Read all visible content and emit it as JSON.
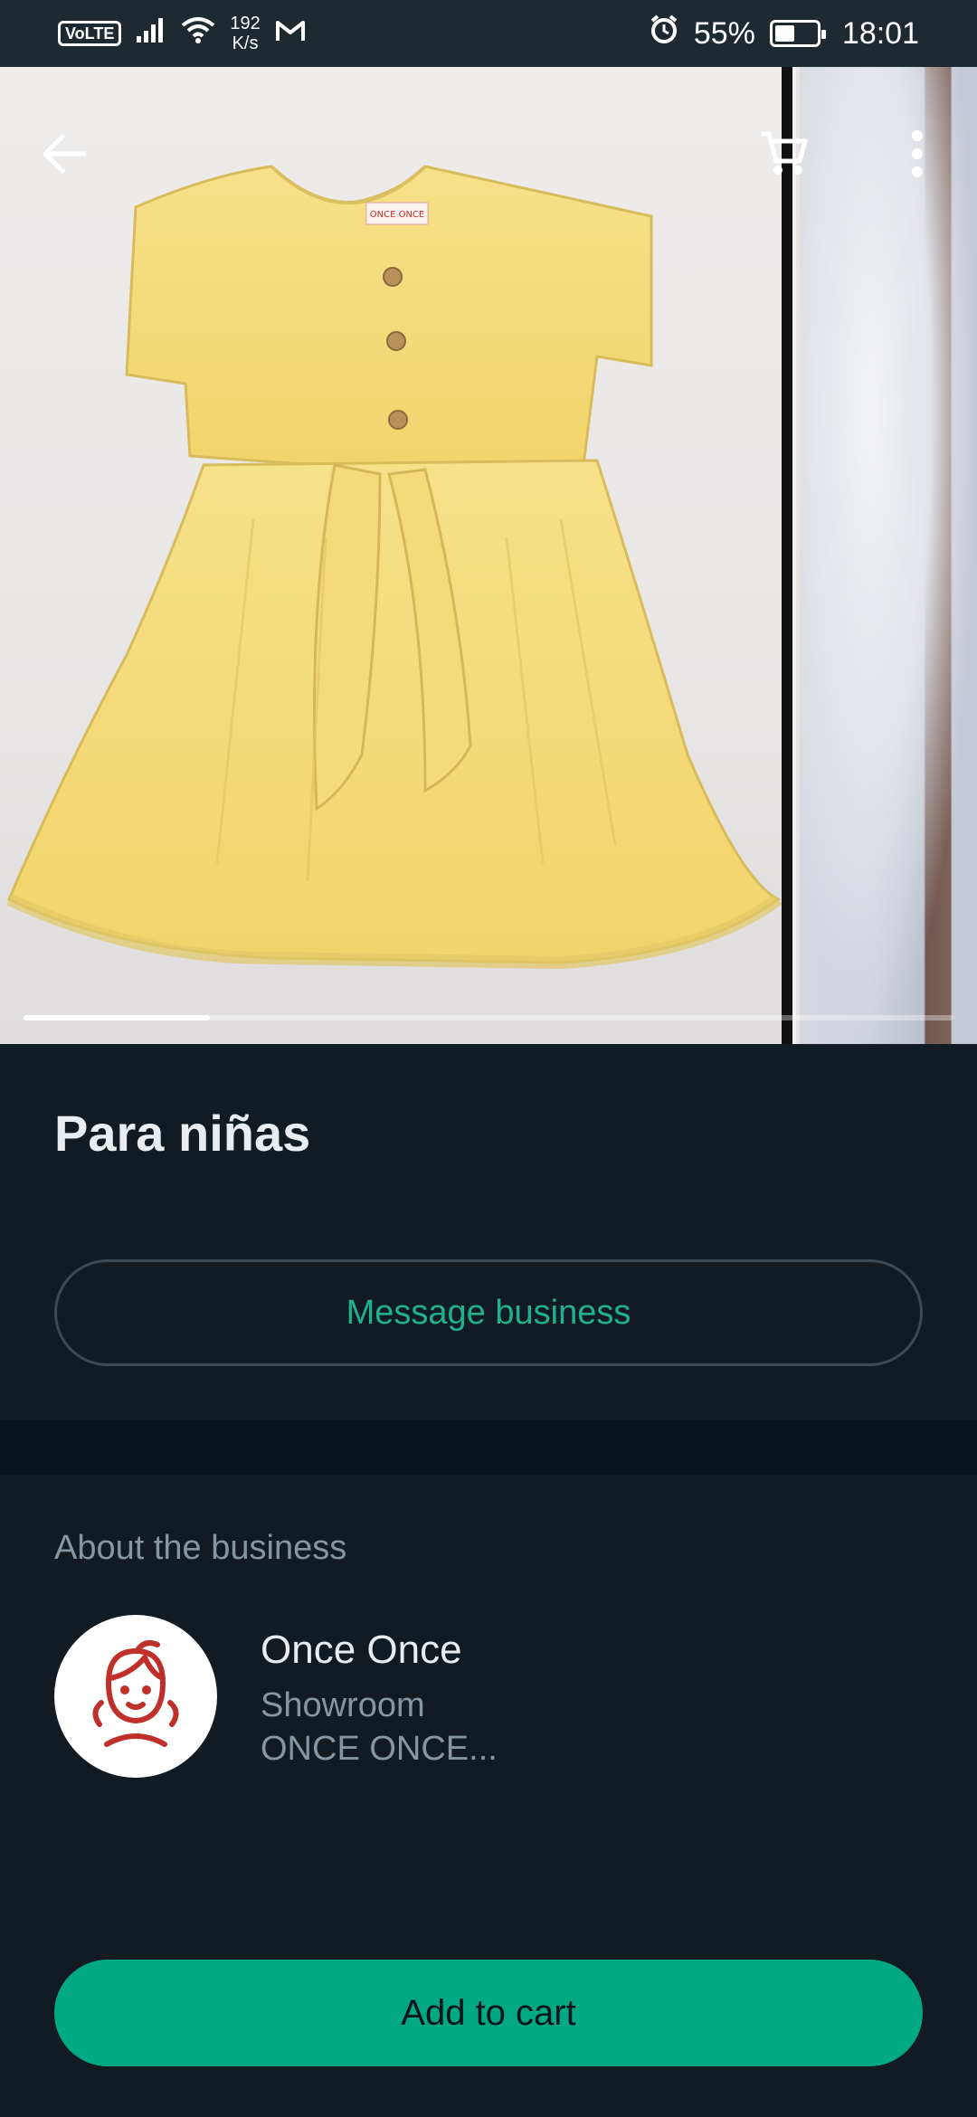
{
  "status_bar": {
    "volte": "VoLTE",
    "net_speed_value": "192",
    "net_speed_unit": "K/s",
    "battery": "55%",
    "battery_level": 0.55,
    "time": "18:01"
  },
  "carousel": {
    "label_tag": "ONCE ONCE",
    "progress": 0.2
  },
  "product": {
    "title": "Para niñas"
  },
  "actions": {
    "message_label": "Message business",
    "add_to_cart_label": "Add to cart"
  },
  "business": {
    "section_label": "About the business",
    "name": "Once Once",
    "description": "Showroom\nONCE ONCE..."
  },
  "colors": {
    "background": "#121b22",
    "accent": "#00a884",
    "accent_text": "#1fb28a",
    "muted_text": "#8696a0",
    "dress": "#f6dc7c"
  },
  "icons": {
    "back": "arrow-left-icon",
    "cart": "cart-icon",
    "more": "more-vertical-icon",
    "signal": "signal-icon",
    "wifi": "wifi-icon",
    "mail": "gmail-icon",
    "alarm": "alarm-icon",
    "battery": "battery-icon"
  }
}
